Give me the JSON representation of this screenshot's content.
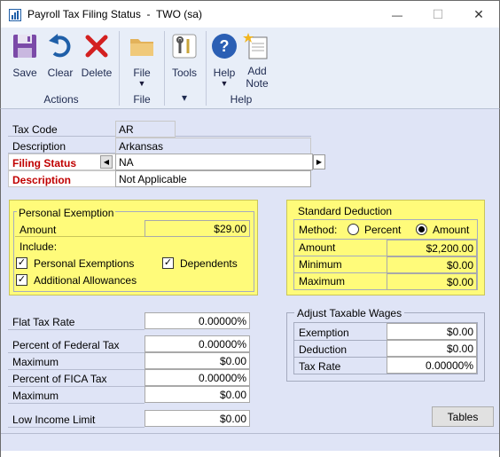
{
  "window": {
    "title": "Payroll Tax Filing Status  -  TWO (sa)",
    "minimize_glyph": "—",
    "maximize_glyph": "☐",
    "close_glyph": "✕"
  },
  "ribbon": {
    "save": "Save",
    "clear": "Clear",
    "delete": "Delete",
    "file": "File",
    "tools": "Tools",
    "help": "Help",
    "add_note_1": "Add",
    "add_note_2": "Note",
    "groups": {
      "actions": "Actions",
      "file": "File",
      "tools_arrow": "▾",
      "help": "Help"
    },
    "icons": {
      "save": "save-icon",
      "clear": "undo-icon",
      "delete": "delete-x-icon",
      "file": "folder-icon",
      "tools": "tools-icon",
      "help": "help-icon",
      "add_note": "note-icon"
    }
  },
  "form": {
    "tax_code_label": "Tax Code",
    "tax_code_value": "AR",
    "description_label": "Description",
    "description_value": "Arkansas",
    "filing_status_label": "Filing Status",
    "filing_status_value": "NA",
    "filing_desc_label": "Description",
    "filing_desc_value": "Not Applicable"
  },
  "personal_exemption": {
    "title": "Personal Exemption",
    "amount_label": "Amount",
    "amount_value": "$29.00",
    "include_label": "Include:",
    "personal_exemptions_label": "Personal Exemptions",
    "personal_exemptions_checked": true,
    "dependents_label": "Dependents",
    "dependents_checked": true,
    "additional_allowances_label": "Additional Allowances",
    "additional_allowances_checked": true
  },
  "standard_deduction": {
    "title": "Standard Deduction",
    "method_label": "Method:",
    "percent_label": "Percent",
    "amount_option_label": "Amount",
    "selected_method": "Amount",
    "amount_label": "Amount",
    "amount_value": "$2,200.00",
    "minimum_label": "Minimum",
    "minimum_value": "$0.00",
    "maximum_label": "Maximum",
    "maximum_value": "$0.00"
  },
  "rates": {
    "flat_tax_rate_label": "Flat Tax Rate",
    "flat_tax_rate_value": "0.00000%",
    "pct_federal_label": "Percent of Federal Tax",
    "pct_federal_value": "0.00000%",
    "max1_label": "Maximum",
    "max1_value": "$0.00",
    "pct_fica_label": "Percent of FICA Tax",
    "pct_fica_value": "0.00000%",
    "max2_label": "Maximum",
    "max2_value": "$0.00",
    "low_income_label": "Low Income Limit",
    "low_income_value": "$0.00"
  },
  "adjust_taxable_wages": {
    "title": "Adjust Taxable Wages",
    "exemption_label": "Exemption",
    "exemption_value": "$0.00",
    "deduction_label": "Deduction",
    "deduction_value": "$0.00",
    "tax_rate_label": "Tax Rate",
    "tax_rate_value": "0.00000%"
  },
  "buttons": {
    "tables": "Tables"
  },
  "colors": {
    "required_label": "#c00000",
    "highlight_yellow": "#fffb7a",
    "form_background": "#dfe4f6",
    "ribbon_background": "#e8eef8",
    "help_icon_blue": "#2b5fb4"
  }
}
